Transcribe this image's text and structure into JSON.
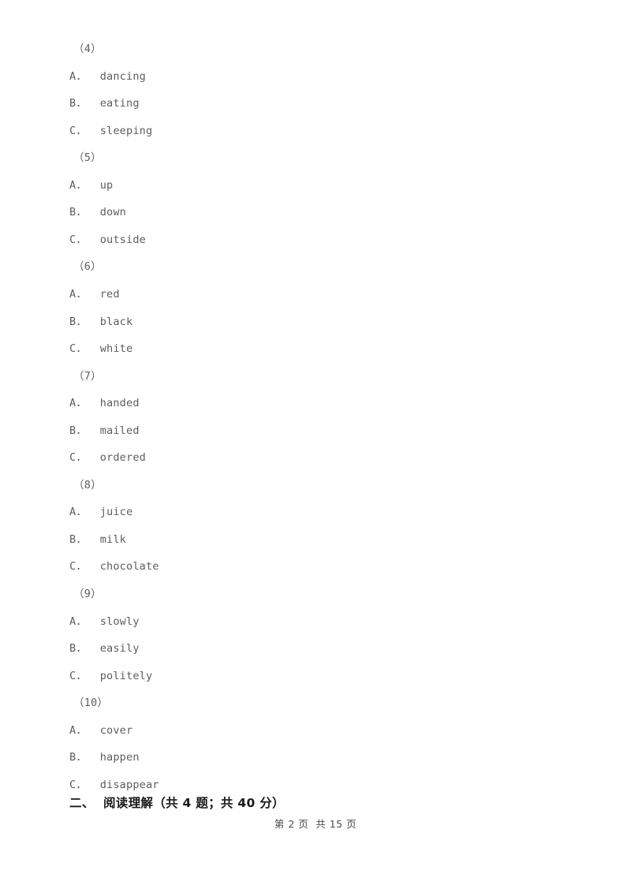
{
  "document": {
    "background_color": "#ffffff",
    "body_text_color": "#5d5d5d",
    "heading_text_color": "#1a1a1a",
    "footer_text_color": "#4a4a4a"
  },
  "questions": [
    {
      "number": "（4）",
      "options": [
        {
          "label": "A．",
          "text": "dancing"
        },
        {
          "label": "B．",
          "text": "eating"
        },
        {
          "label": "C．",
          "text": "sleeping"
        }
      ]
    },
    {
      "number": "（5）",
      "options": [
        {
          "label": "A．",
          "text": "up"
        },
        {
          "label": "B．",
          "text": "down"
        },
        {
          "label": "C．",
          "text": "outside"
        }
      ]
    },
    {
      "number": "（6）",
      "options": [
        {
          "label": "A．",
          "text": "red"
        },
        {
          "label": "B．",
          "text": "black"
        },
        {
          "label": "C．",
          "text": "white"
        }
      ]
    },
    {
      "number": "（7）",
      "options": [
        {
          "label": "A．",
          "text": "handed"
        },
        {
          "label": "B．",
          "text": "mailed"
        },
        {
          "label": "C．",
          "text": "ordered"
        }
      ]
    },
    {
      "number": "（8）",
      "options": [
        {
          "label": "A．",
          "text": "juice"
        },
        {
          "label": "B．",
          "text": "milk"
        },
        {
          "label": "C．",
          "text": "chocolate"
        }
      ]
    },
    {
      "number": "（9）",
      "options": [
        {
          "label": "A．",
          "text": "slowly"
        },
        {
          "label": "B．",
          "text": "easily"
        },
        {
          "label": "C．",
          "text": "politely"
        }
      ]
    },
    {
      "number": "（10）",
      "options": [
        {
          "label": "A．",
          "text": "cover"
        },
        {
          "label": "B．",
          "text": "happen"
        },
        {
          "label": "C．",
          "text": "disappear"
        }
      ]
    }
  ],
  "section_heading": "二、  阅读理解（共 4 题；共 40 分）",
  "footer": "第 2 页  共 15 页"
}
